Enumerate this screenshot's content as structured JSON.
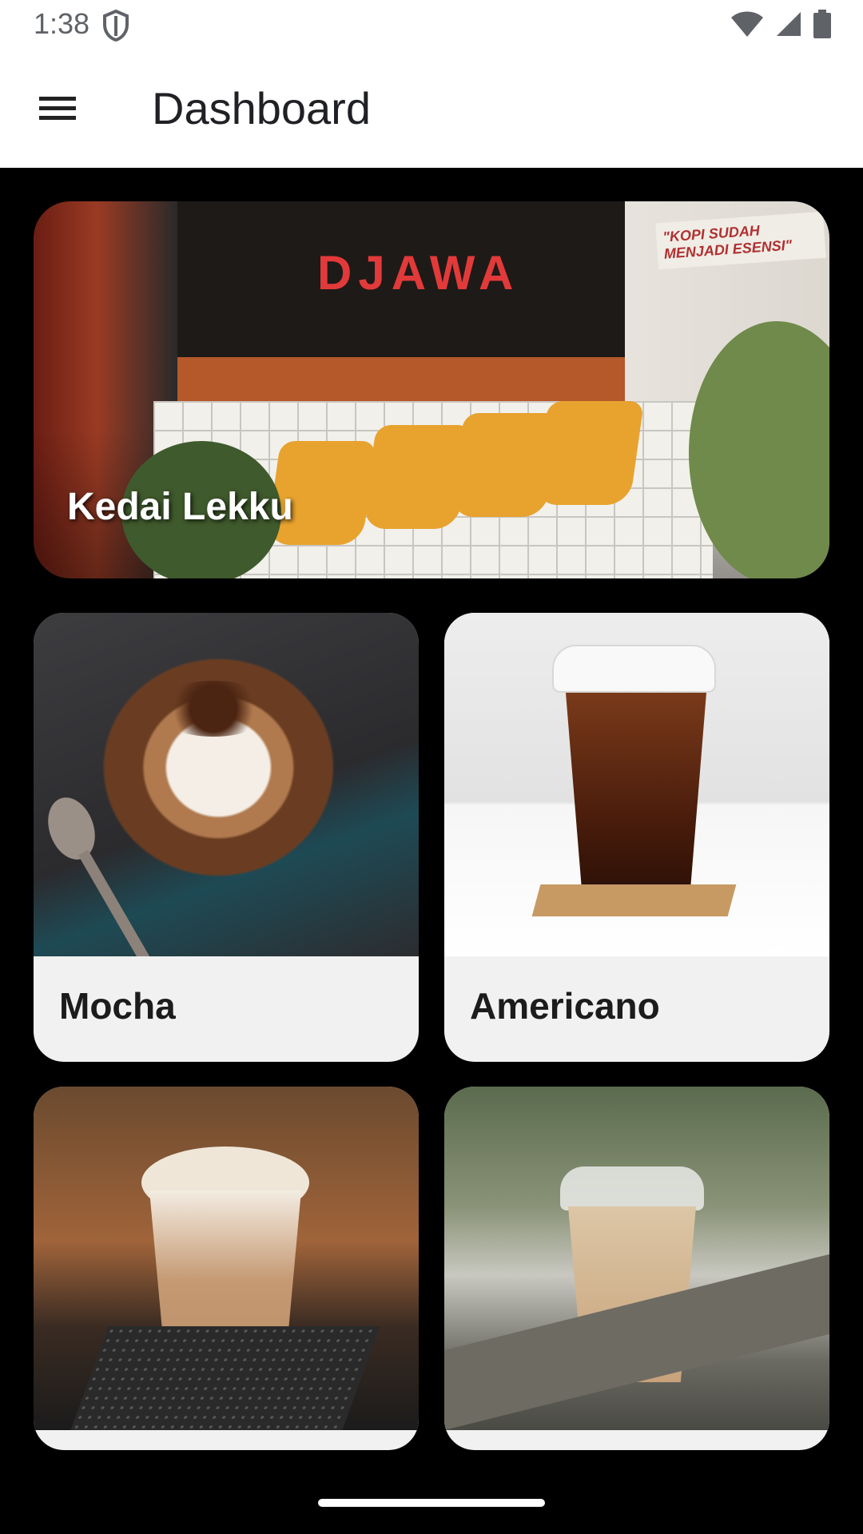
{
  "status_bar": {
    "time": "1:38"
  },
  "app_bar": {
    "title": "Dashboard"
  },
  "hero": {
    "title": "Kedai Lekku",
    "sign_text": "DJAWA",
    "quote_text": "\"KOPI SUDAH MENJADI ESENSI\""
  },
  "menu_items": [
    {
      "label": "Mocha"
    },
    {
      "label": "Americano"
    },
    {
      "label": ""
    },
    {
      "label": ""
    }
  ],
  "colors": {
    "app_bar_bg": "#ffffff",
    "content_bg": "#000000",
    "card_bg": "#f1f1f1"
  },
  "icons": [
    "shield-icon",
    "wifi-icon",
    "signal-icon",
    "battery-icon",
    "menu-icon"
  ]
}
